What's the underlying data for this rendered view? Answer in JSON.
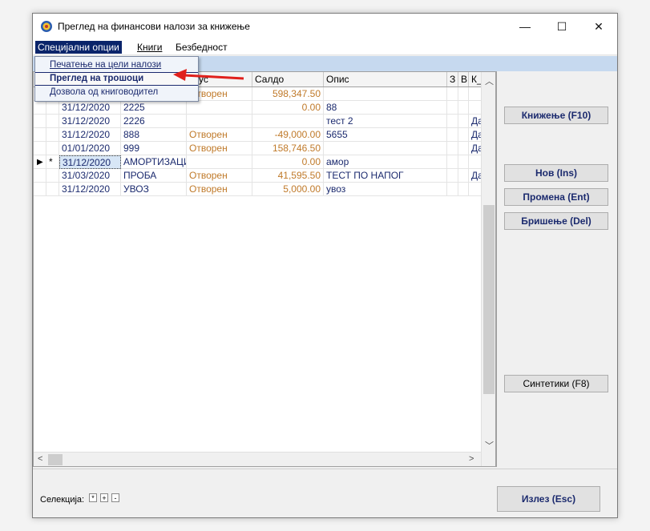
{
  "window": {
    "title": "Преглед на финансови налози за книжење",
    "minimize_glyph": "—",
    "maximize_glyph": "☐",
    "close_glyph": "✕"
  },
  "menu": {
    "items": [
      {
        "label": "Специјални опции"
      },
      {
        "label": "Книги"
      },
      {
        "label": "Безбедност"
      }
    ]
  },
  "dropdown": {
    "items": [
      {
        "label": "Печатење на цели налози"
      },
      {
        "label": "Преглед на трошоци"
      },
      {
        "label": "Дозвола од книговодител"
      }
    ]
  },
  "grid": {
    "headers": {
      "status": "атус",
      "saldo": "Салдо",
      "opis": "Опис",
      "z": "З",
      "v": "В",
      "k": "К_"
    },
    "rows": [
      {
        "marker": "",
        "star": "",
        "date": "",
        "number": "",
        "status": "Отворен",
        "saldo": "598,347.50",
        "opis": "",
        "k": ""
      },
      {
        "marker": "",
        "star": "",
        "date": "31/12/2020",
        "number": "2225",
        "status": "",
        "saldo": "0.00",
        "opis": "88",
        "k": ""
      },
      {
        "marker": "",
        "star": "",
        "date": "31/12/2020",
        "number": "2226",
        "status": "",
        "saldo": "",
        "opis": "тест 2",
        "k": "Да"
      },
      {
        "marker": "",
        "star": "",
        "date": "31/12/2020",
        "number": "888",
        "status": "Отворен",
        "saldo": "-49,000.00",
        "opis": "5655",
        "k": "Да"
      },
      {
        "marker": "",
        "star": "",
        "date": "01/01/2020",
        "number": "999",
        "status": "Отворен",
        "saldo": "158,746.50",
        "opis": "",
        "k": "Да"
      },
      {
        "marker": "▶",
        "star": "*",
        "date": "31/12/2020",
        "number": "АМОРТИЗАЦИ",
        "status": "",
        "saldo": "0.00",
        "opis": "амор",
        "k": ""
      },
      {
        "marker": "",
        "star": "",
        "date": "31/03/2020",
        "number": "ПРОБА",
        "status": "Отворен",
        "saldo": "41,595.50",
        "opis": "ТЕСТ ПО НАПОГ",
        "k": "Да"
      },
      {
        "marker": "",
        "star": "",
        "date": "31/12/2020",
        "number": "УВОЗ",
        "status": "Отворен",
        "saldo": "5,000.00",
        "opis": "увоз",
        "k": ""
      }
    ]
  },
  "buttons": {
    "knizenje": "Книжење (F10)",
    "nov": "Нов (Ins)",
    "promena": "Промена (Ent)",
    "brisenje": "Бришење (Del)",
    "sintetiki": "Синтетики (F8)",
    "izlez": "Излез (Esc)"
  },
  "selection": {
    "label": "Селекција:",
    "star": "*",
    "plus": "+",
    "minus": "-"
  },
  "colors": {
    "status_text": "#c07a2a",
    "navy_text": "#1b2a6e",
    "highlight_arrow": "#e0201c",
    "header_band": "#c6d9ef"
  }
}
